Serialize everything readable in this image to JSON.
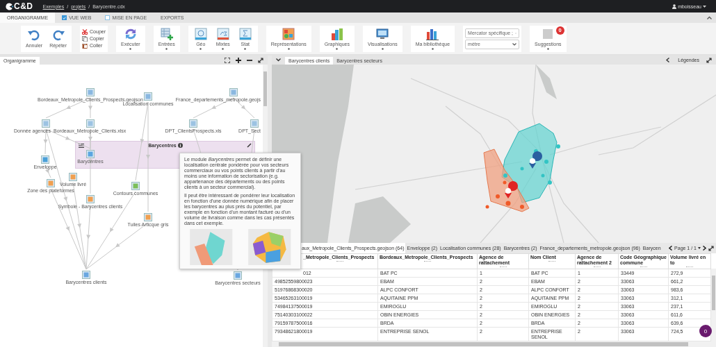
{
  "topbar": {
    "logo": "C&D",
    "breadcrumb": [
      {
        "kind": "link",
        "label": "Exemples"
      },
      {
        "kind": "sep",
        "label": "/"
      },
      {
        "kind": "link",
        "label": "projets"
      },
      {
        "kind": "sep",
        "label": "/"
      },
      {
        "kind": "current",
        "label": "Barycentre.cdx"
      }
    ],
    "user": "mboisseau"
  },
  "tabs": [
    {
      "label": "ORGANIGRAMME",
      "selected": true
    },
    {
      "label": "VUE WEB",
      "selected": false,
      "checked": true
    },
    {
      "label": "MISE EN PAGE",
      "selected": false,
      "checked": false
    },
    {
      "label": "EXPORTS",
      "selected": false
    }
  ],
  "ribbon": {
    "groups": [
      {
        "items": [
          {
            "kind": "button",
            "label": "Annuler"
          },
          {
            "kind": "button",
            "label": "Répéter"
          }
        ]
      },
      {
        "items": [
          {
            "kind": "stack",
            "labels": [
              "Couper",
              "Copier",
              "Coller"
            ]
          }
        ]
      },
      {
        "items": [
          {
            "kind": "menu",
            "label": "Exécuter"
          }
        ]
      },
      {
        "items": [
          {
            "kind": "menu",
            "label": "Entrées"
          }
        ]
      },
      {
        "items": [
          {
            "kind": "menu",
            "label": "Géo"
          },
          {
            "kind": "menu",
            "label": "Mixtes"
          },
          {
            "kind": "menu",
            "label": "Stat"
          }
        ]
      },
      {
        "items": [
          {
            "kind": "menu",
            "label": "Représentations"
          }
        ]
      },
      {
        "items": [
          {
            "kind": "menu",
            "label": "Graphiques"
          }
        ]
      },
      {
        "items": [
          {
            "kind": "menu",
            "label": "Visualisations"
          }
        ]
      },
      {
        "items": [
          {
            "kind": "menu",
            "label": "Ma bibliothèque"
          }
        ]
      },
      {
        "items": [
          {
            "kind": "selects",
            "values": [
              "Mercator spécifique ;",
              "mètre"
            ]
          }
        ]
      },
      {
        "items": [
          {
            "kind": "menu",
            "label": "Suggestions",
            "badge": "0"
          }
        ]
      }
    ]
  },
  "organigram": {
    "tab": "Organigramme",
    "group_title": "Barycentres",
    "nodes": [
      {
        "label": "Bordeaux_Metropole_Clients_Prospects.geojson"
      },
      {
        "label": "Localisation communes"
      },
      {
        "label": "France_departements_metropole.geojs"
      },
      {
        "label": "Donnée agences"
      },
      {
        "label": "Bordeaux_Metropole_Clients.xlsx"
      },
      {
        "label": "DPT_ClientsProspects.xls"
      },
      {
        "label": "DPT_Sect"
      },
      {
        "label": "Barycentres"
      },
      {
        "label": "Enveloppe"
      },
      {
        "label": "Volume livré"
      },
      {
        "label": "Zone des plateformes"
      },
      {
        "label": "Symbole - Barycentres clients"
      },
      {
        "label": "Contours communes"
      },
      {
        "label": "Tuiles Articque gris"
      },
      {
        "label": "Barycentres clients"
      },
      {
        "label": "Barycentres secteurs"
      }
    ]
  },
  "tooltip": {
    "paragraphs": [
      "Le module *Barycentres* permet de définir une localisation centrale pondérée pour vos secteurs commerciaux ou vos points clients à partir d'au moins une information de sectorisation (e.g. appartenance des départements ou des points clients à un secteur commercial).",
      "Il peut être intéressant de pondérer leur localisation en fonction d'une donnée numérique afin de placer les barycentres au plus près du potentiel, par exemple en fonction d'un montant facturé ou d'un volume de livraison comme dans les cas présentés dans cet exemple."
    ]
  },
  "map_tabs": [
    {
      "label": "Barycentres clients",
      "selected": true
    },
    {
      "label": "Barycentres secteurs",
      "selected": false
    }
  ],
  "legend_label": "Légendes",
  "data_tabs": [
    {
      "label": "aux_Metropole_Clients_Prospects.geojson (64)",
      "selected": true
    },
    {
      "label": "Enveloppe (2)",
      "selected": false
    },
    {
      "label": "Localisation communes (28)",
      "selected": false
    },
    {
      "label": "Barycentres (2)",
      "selected": false
    },
    {
      "label": "France_departements_metropole.geojson (96)",
      "selected": false
    },
    {
      "label": "Barycen",
      "selected": false
    }
  ],
  "pager": "Page 1 / 1",
  "table": {
    "columns": [
      "_Metropole_Clients_Prospects",
      "Bordeaux_Metropole_Clients_Prospects",
      "Agence de rattachement",
      "Nom Client",
      "Agence de rattachement 2",
      "Code Géographique commune",
      "Volume livré en to"
    ],
    "rows": [
      [
        "012",
        "BAT PC",
        "1",
        "BAT PC",
        "1",
        "33449",
        "272,9"
      ],
      [
        "49852559800023",
        "EBAM",
        "2",
        "EBAM",
        "2",
        "33063",
        "661,2"
      ],
      [
        "51976868300020",
        "ALPC CONFORT",
        "2",
        "ALPC CONFORT",
        "2",
        "33063",
        "983,6"
      ],
      [
        "53465263100019",
        "AQUITAINE PPM",
        "2",
        "AQUITAINE PPM",
        "2",
        "33063",
        "312,1"
      ],
      [
        "74984137500019",
        "EMIROGLU",
        "2",
        "EMIROGLU",
        "2",
        "33063",
        "237,1"
      ],
      [
        "75140303100022",
        "OBIN ENERGIES",
        "2",
        "OBIN ENERGIES",
        "2",
        "33063",
        "611,6"
      ],
      [
        "79159787500016",
        "BRDA",
        "2",
        "BRDA",
        "2",
        "33063",
        "639,6"
      ],
      [
        "79348621800019",
        "ENTREPRISE SENOL",
        "2",
        "ENTREPRISE SENOL",
        "2",
        "33063",
        "724,5"
      ]
    ]
  },
  "corner_badge": "0"
}
